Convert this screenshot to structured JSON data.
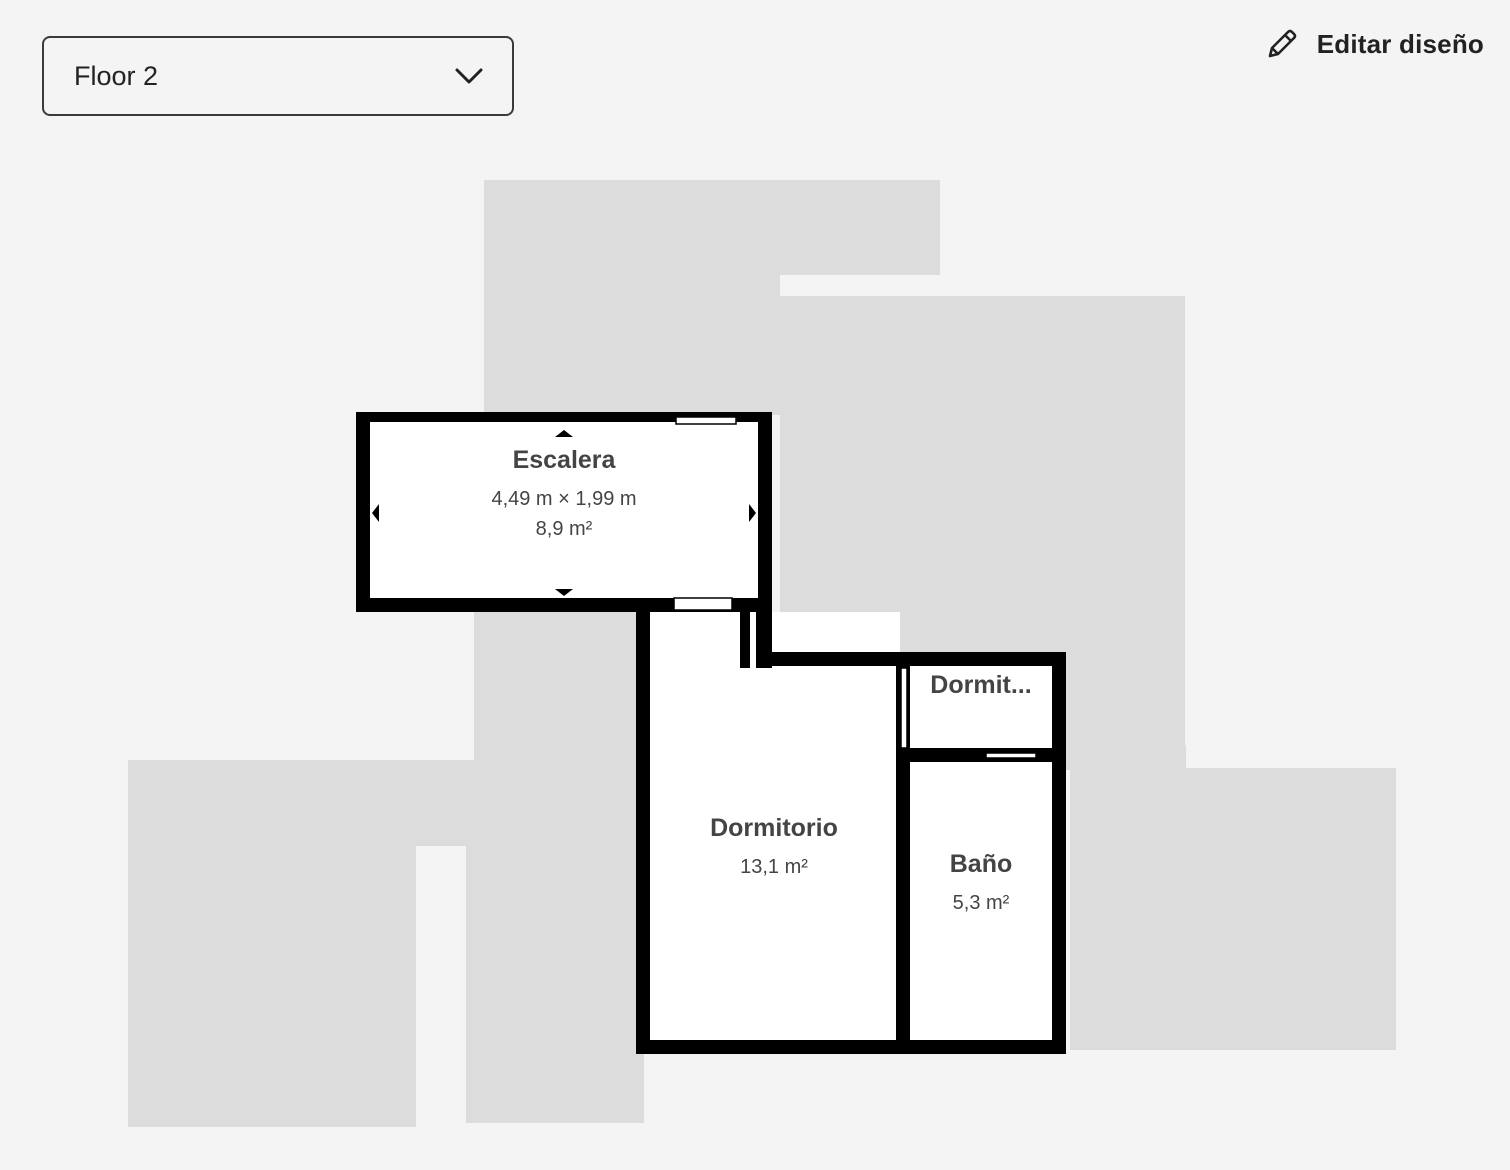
{
  "floor_selector": {
    "value": "Floor 2",
    "icon": "chevron-down-icon"
  },
  "edit_layout": {
    "label": "Editar diseño",
    "icon": "pencil-icon"
  },
  "rooms": {
    "escalera": {
      "name": "Escalera",
      "dimensions": "4,49 m × 1,99 m",
      "area": "8,9 m²"
    },
    "dormitorio": {
      "name": "Dormitorio",
      "area": "13,1 m²"
    },
    "dormitorio_small": {
      "name": "Dormit..."
    },
    "bano": {
      "name": "Baño",
      "area": "5,3 m²"
    }
  },
  "colors": {
    "background": "#f4f4f4",
    "ghost_rooms": "#dcdcdc",
    "walls": "#000000",
    "text": "#444444"
  }
}
